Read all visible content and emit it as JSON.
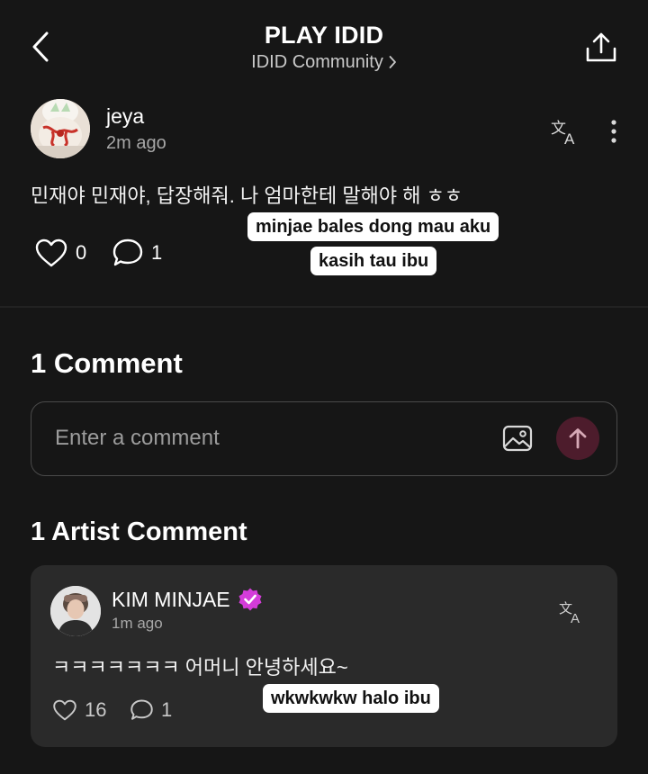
{
  "header": {
    "title": "PLAY IDID",
    "breadcrumb": "IDID Community"
  },
  "post": {
    "username": "jeya",
    "timestamp": "2m ago",
    "text": "민재야 민재야, 답장해줘. 나 엄마한테 말해야 해 ㅎㅎ",
    "likes": "0",
    "comments": "1",
    "caption_line1": "minjae bales dong mau aku",
    "caption_line2": "kasih tau ibu"
  },
  "comments_section": {
    "title": "1 Comment",
    "input_placeholder": "Enter a comment"
  },
  "artist_section": {
    "title": "1 Artist Comment",
    "name": "KIM MINJAE",
    "timestamp": "1m ago",
    "text": "ㅋㅋㅋㅋㅋㅋㅋ 어머니 안녕하세요~",
    "likes": "16",
    "comments": "1",
    "caption": "wkwkwkw halo ibu"
  },
  "colors": {
    "background": "#161616",
    "card": "#2a2a2a",
    "send_button": "#4d1c2c",
    "verified_badge": "#d43cd9"
  },
  "icons": [
    "back-arrow-icon",
    "chevron-right-icon",
    "share-icon",
    "translate-icon",
    "more-vertical-icon",
    "heart-icon",
    "comment-bubble-icon",
    "image-icon",
    "arrow-up-icon",
    "verified-badge-icon"
  ]
}
